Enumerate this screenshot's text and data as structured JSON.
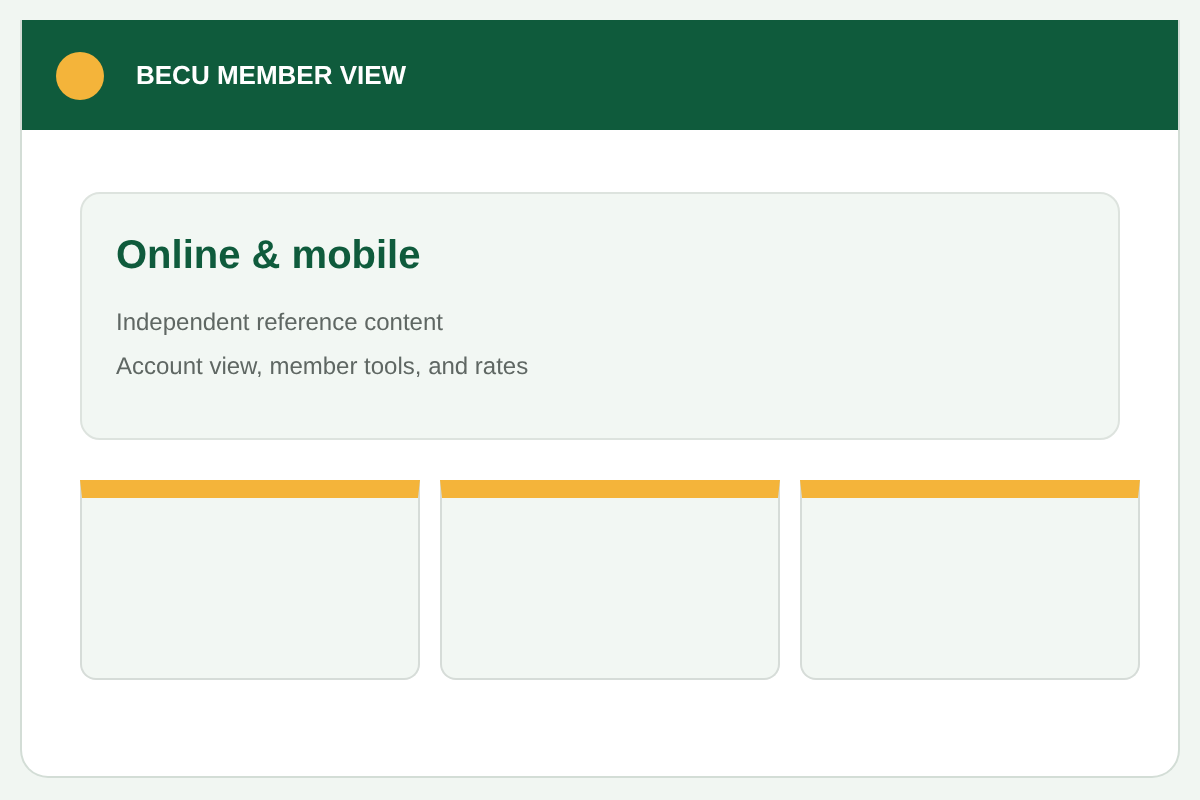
{
  "header": {
    "title": "BECU MEMBER VIEW"
  },
  "intro": {
    "heading": "Online & mobile",
    "lines": [
      "Independent reference content",
      "Account view, member tools, and rates"
    ]
  },
  "tiles": [
    {
      "kind": "accent"
    },
    {
      "kind": "accent"
    },
    {
      "kind": "accent"
    }
  ]
}
